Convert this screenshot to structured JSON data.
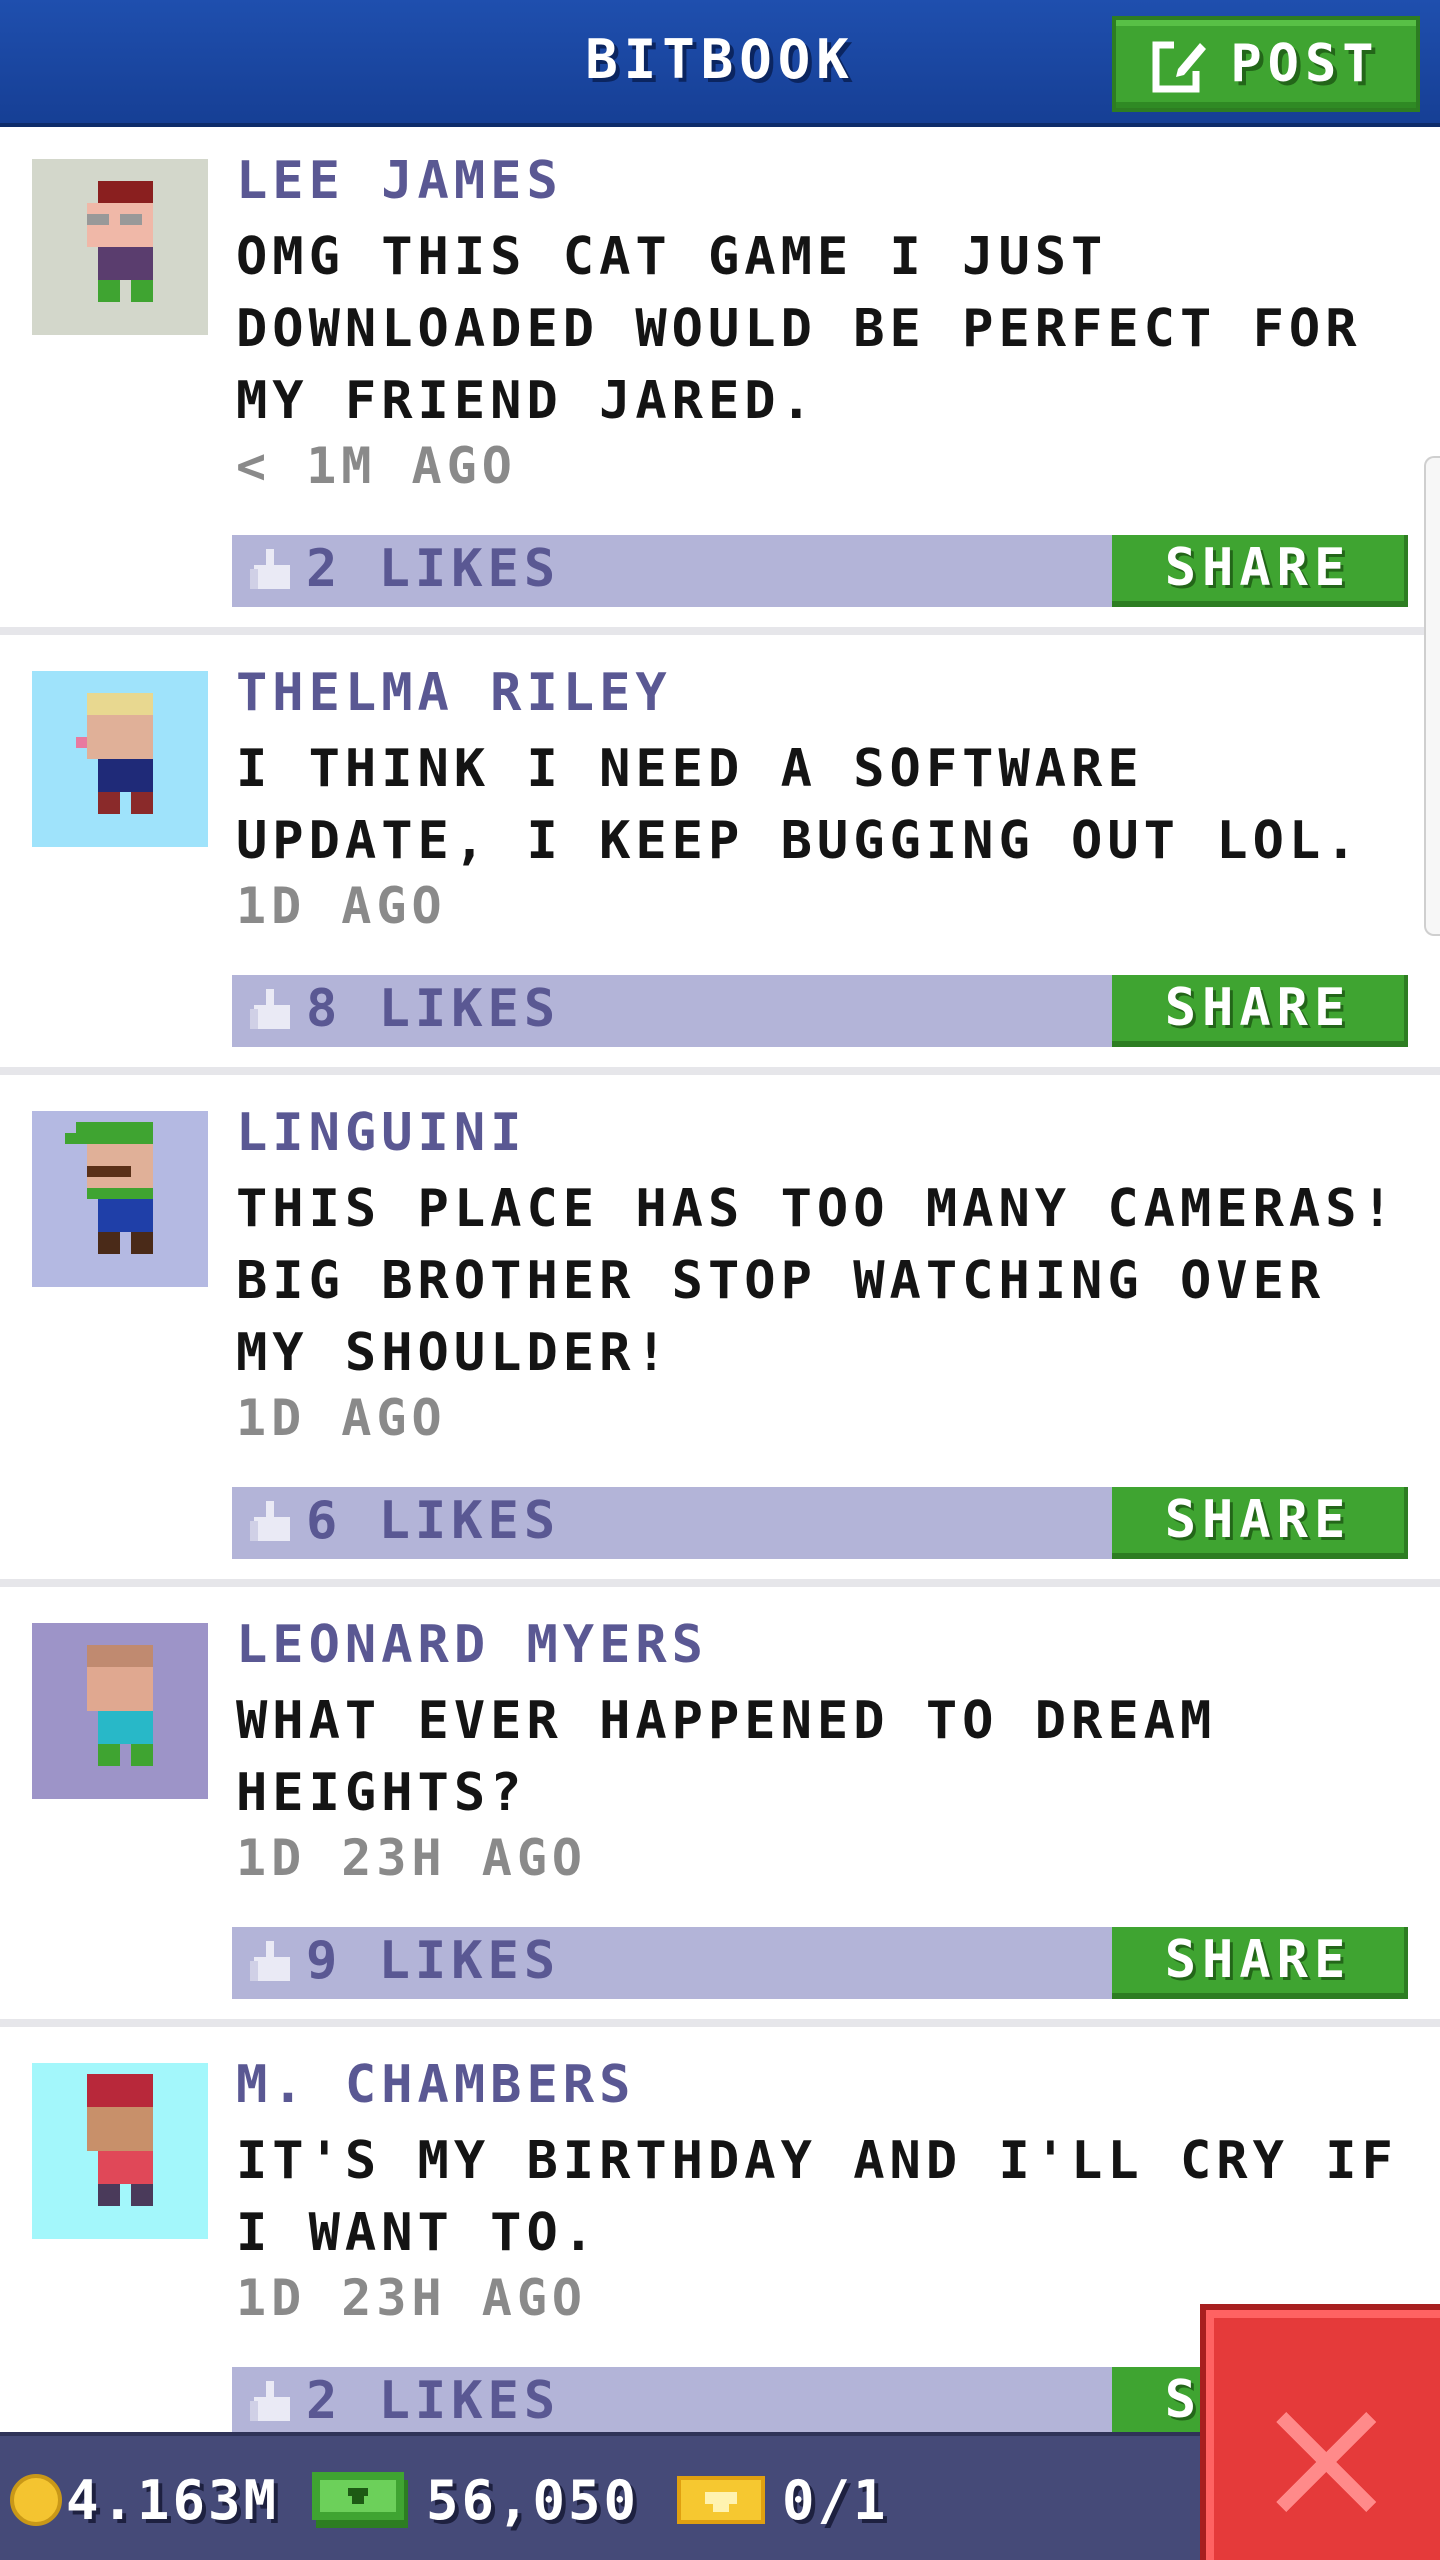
{
  "header": {
    "title": "BITBOOK",
    "post_label": "POST"
  },
  "posts": [
    {
      "name": "LEE JAMES",
      "text": "OMG THIS CAT GAME I JUST DOWNLOADED WOULD BE PERFECT FOR MY FRIEND JARED.",
      "time": "< 1M AGO",
      "likes": "2 LIKES",
      "share": "SHARE",
      "avatar_bg": "#d3d7cb"
    },
    {
      "name": "THELMA RILEY",
      "text": "I THINK I NEED A SOFTWARE UPDATE, I KEEP BUGGING OUT LOL.",
      "time": "1D AGO",
      "likes": "8 LIKES",
      "share": "SHARE",
      "avatar_bg": "#9fe3fb"
    },
    {
      "name": "LINGUINI",
      "text": "THIS PLACE HAS TOO MANY CAMERAS! BIG BROTHER STOP WATCHING OVER MY SHOULDER!",
      "time": "1D AGO",
      "likes": "6 LIKES",
      "share": "SHARE",
      "avatar_bg": "#b4b9e2"
    },
    {
      "name": "LEONARD MYERS",
      "text": "WHAT EVER HAPPENED TO DREAM HEIGHTS?",
      "time": "1D 23H AGO",
      "likes": "9 LIKES",
      "share": "SHARE",
      "avatar_bg": "#9d94c8"
    },
    {
      "name": "M. CHAMBERS",
      "text": "IT'S MY BIRTHDAY AND I'LL CRY IF I WANT TO.",
      "time": "1D 23H AGO",
      "likes": "2 LIKES",
      "share": "SHARE",
      "avatar_bg": "#a3f7fb"
    }
  ],
  "bottom_bar": {
    "coins": "4.163M",
    "bux": "56,050",
    "tickets": "0/1"
  },
  "colors": {
    "header": "#1f4fae",
    "green": "#3fa431",
    "likes_bar": "#b3b4d8",
    "name": "#5a5893",
    "close": "#e53a3a"
  }
}
